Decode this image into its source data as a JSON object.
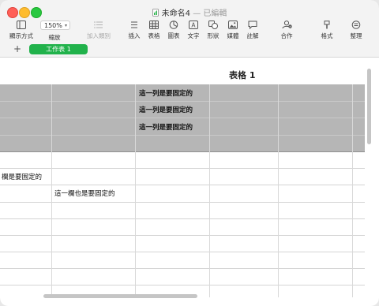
{
  "window": {
    "title": "未命名4",
    "separator": "—",
    "status": "已編輯"
  },
  "toolbar": {
    "view_label": "顯示方式",
    "zoom_value": "150%",
    "zoom_label": "縮放",
    "add_category_label": "加入類別",
    "insert_label": "插入",
    "table_label": "表格",
    "chart_label": "圖表",
    "text_label": "文字",
    "shape_label": "形狀",
    "media_label": "媒體",
    "comment_label": "註解",
    "collaborate_label": "合作",
    "format_label": "格式",
    "organize_label": "整理"
  },
  "sheets": {
    "add_symbol": "+",
    "active_tab": "工作表 1"
  },
  "table": {
    "title": "表格 1",
    "frozen_rows": [
      "這一列是要固定的",
      "這一列是要固定的",
      "這一列是要固定的"
    ],
    "frozen_col_cell": "欄是要固定的",
    "frozen_col_cell_2": "這一欄也是要固定的"
  }
}
